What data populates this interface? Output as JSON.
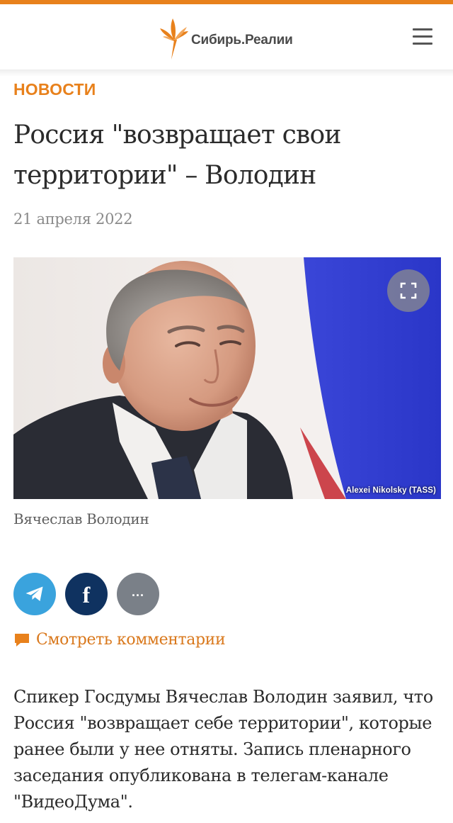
{
  "header": {
    "logo_text": "Сибирь.Реалии",
    "logo_icon": "flame-logo-icon",
    "menu_icon": "hamburger-menu-icon"
  },
  "article": {
    "section": "НОВОСТИ",
    "title": "Россия \"возвращает свои территории\" – Володин",
    "date": "21 апреля 2022",
    "photo": {
      "credit": "Alexei Nikolsky (TASS)",
      "caption": "Вячеслав Володин",
      "fullscreen_icon": "expand-icon"
    },
    "share": [
      {
        "name": "telegram",
        "icon": "telegram-icon"
      },
      {
        "name": "facebook",
        "icon": "facebook-icon"
      },
      {
        "name": "more",
        "icon": "more-dots-icon"
      }
    ],
    "comments_label": "Смотреть комментарии",
    "body": "Спикер Госдумы Вячеслав Володин заявил, что Россия \"возвращает себе территории\", которые ранее были у нее отняты. Запись пленарного заседания опубликована в телегам-канале \"ВидеоДума\"."
  },
  "colors": {
    "accent": "#e8811c",
    "telegram": "#3aa3dd",
    "facebook": "#0f3260",
    "more": "#7a8088"
  }
}
